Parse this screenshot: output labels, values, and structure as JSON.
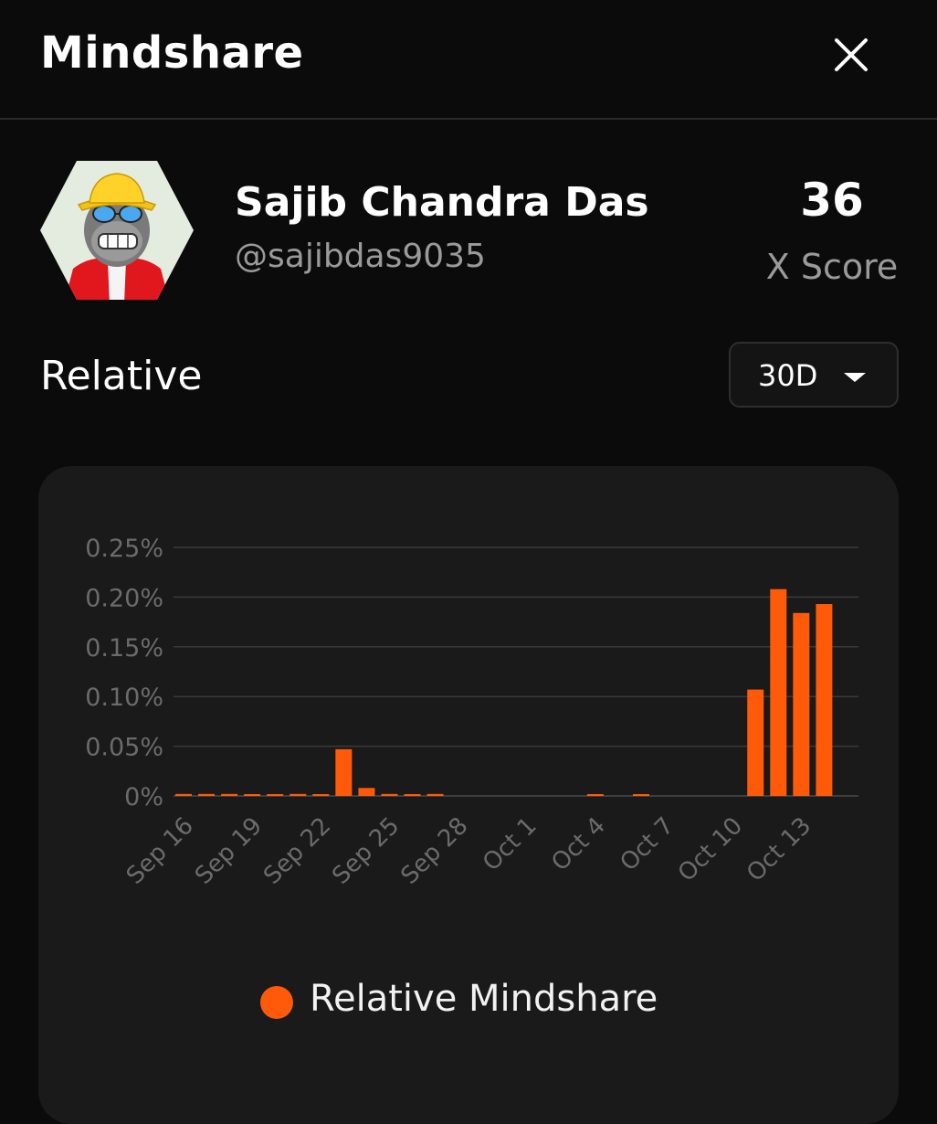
{
  "header": {
    "title": "Mindshare",
    "close_icon": "close-icon"
  },
  "profile": {
    "name": "Sajib Chandra Das",
    "handle": "@sajibdas9035",
    "score": "36",
    "score_label": "X Score",
    "avatar_icon": "avatar-ape-yellow-hat"
  },
  "section": {
    "label": "Relative"
  },
  "period": {
    "selected": "30D",
    "caret_icon": "caret-down-icon"
  },
  "colors": {
    "accent": "#ff5a0a",
    "grid": "#3a3a3a",
    "tick": "#6b6b6b"
  },
  "chart_data": {
    "type": "bar",
    "ylim": [
      0,
      0.25
    ],
    "yticks": [
      0,
      0.05,
      0.1,
      0.15,
      0.2,
      0.25
    ],
    "ytick_labels": [
      "0%",
      "0.05%",
      "0.10%",
      "0.15%",
      "0.20%",
      "0.25%"
    ],
    "categories": [
      "Sep 16",
      "Sep 17",
      "Sep 18",
      "Sep 19",
      "Sep 20",
      "Sep 21",
      "Sep 22",
      "Sep 23",
      "Sep 24",
      "Sep 25",
      "Sep 26",
      "Sep 27",
      "Sep 28",
      "Sep 29",
      "Sep 30",
      "Oct 1",
      "Oct 2",
      "Oct 3",
      "Oct 4",
      "Oct 5",
      "Oct 6",
      "Oct 7",
      "Oct 8",
      "Oct 9",
      "Oct 10",
      "Oct 11",
      "Oct 12",
      "Oct 13",
      "Oct 14"
    ],
    "xtick_labels": [
      "Sep 16",
      "Sep 19",
      "Sep 22",
      "Sep 25",
      "Sep 28",
      "Oct 1",
      "Oct 4",
      "Oct 7",
      "Oct 10",
      "Oct 13"
    ],
    "series": [
      {
        "name": "Relative Mindshare",
        "values": [
          0.002,
          0.002,
          0.002,
          0.001,
          0.001,
          0.002,
          0.001,
          0.047,
          0.008,
          0.002,
          0.001,
          0.002,
          0,
          0,
          0,
          0,
          0,
          0,
          0.001,
          0,
          0.001,
          0,
          0,
          0,
          0,
          0.107,
          0.208,
          0.184,
          0.193
        ]
      }
    ],
    "grid": true,
    "legend": "bottom"
  }
}
